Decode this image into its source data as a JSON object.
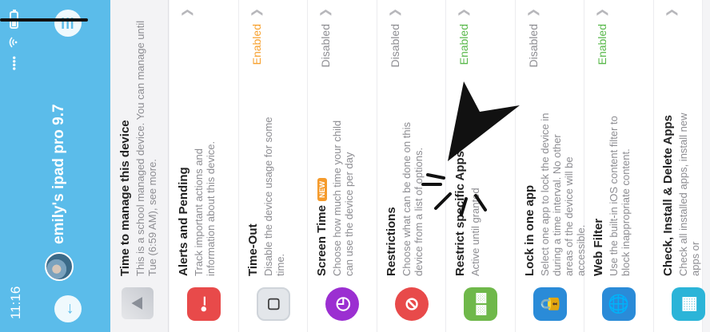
{
  "status_bar": {
    "time": "11:16"
  },
  "header": {
    "device_name": "emily's ipad pro 9.7"
  },
  "info": {
    "title": "Time to manage this device",
    "subtitle": "This is a school managed device. You can manage until Tue (6:59 AM), see more."
  },
  "items": [
    {
      "title": "Alerts and Pending",
      "description": "Track important actions and information about this device.",
      "status": "",
      "status_type": "none",
      "icon": "alert-icon",
      "color": "#e84a4a",
      "new": false
    },
    {
      "title": "Time-Out",
      "description": "Disable the device usage for some time.",
      "status": "Enabled",
      "status_type": "enabled-orange",
      "icon": "timeout-icon",
      "color": "#d9dde3",
      "new": false
    },
    {
      "title": "Screen Time",
      "description": "Choose how much time your child can use the device per day",
      "status": "Disabled",
      "status_type": "disabled",
      "icon": "screen-time-icon",
      "color": "#9b2fd1",
      "new": true,
      "badge": "NEW"
    },
    {
      "title": "Restrictions",
      "description": "Choose what can be done on this device from a list of options.",
      "status": "Disabled",
      "status_type": "disabled",
      "icon": "restrictions-icon",
      "color": "#e84a4a",
      "new": false
    },
    {
      "title": "Restrict specific Apps",
      "description": "Active until granted",
      "status": "Enabled",
      "status_type": "enabled-green",
      "icon": "apps-icon",
      "color": "#6fb84a",
      "new": false
    },
    {
      "title": "Lock in one app",
      "description": "Select one app to lock the device in during a time interval. No other areas of the device will be accessible.",
      "status": "Disabled",
      "status_type": "disabled",
      "icon": "lock-icon",
      "color": "#2a8bd8",
      "new": false
    },
    {
      "title": "Web Filter",
      "description": "Use the built-in iOS content filter to block inappropriate content.",
      "status": "Enabled",
      "status_type": "enabled-green",
      "icon": "web-filter-icon",
      "color": "#2a8bd8",
      "new": false
    },
    {
      "title": "Check, Install & Delete Apps",
      "description": "Check all installed apps, install new apps or",
      "status": "",
      "status_type": "none",
      "icon": "install-apps-icon",
      "color": "#2bb4d8",
      "new": false
    }
  ]
}
